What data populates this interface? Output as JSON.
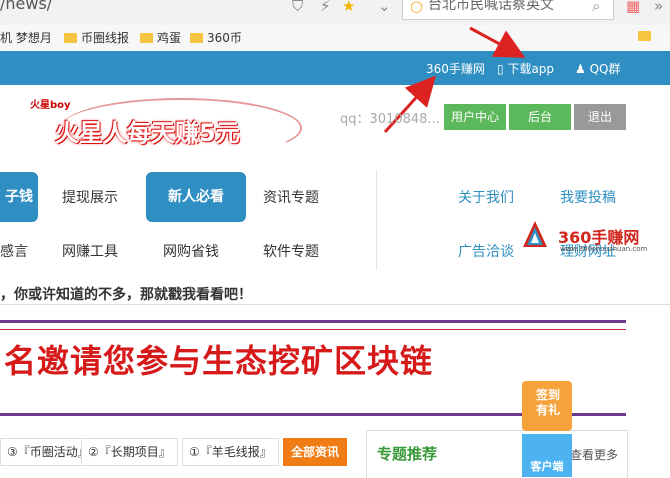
{
  "browser": {
    "url_fragment": "/news/",
    "search_placeholder": "台北市民喊话蔡英文",
    "bookmarks": [
      "机 梦想月",
      "币圈线报",
      "鸡蛋",
      "360币"
    ]
  },
  "topbar": {
    "links": [
      "360手赚网",
      "下载app",
      "QQ群"
    ]
  },
  "header": {
    "logo_small": "火星boy",
    "logo_slogan": "火星人每天赚5元",
    "qq": "qq：3010848...",
    "buttons": [
      "用户中心",
      "后台",
      "退出"
    ],
    "colors": {
      "user_center": "#5cb85c",
      "backend": "#5cb85c",
      "logout": "#999999"
    }
  },
  "nav": {
    "row1": [
      "子钱",
      "提现展示",
      "新人必看",
      "资讯专题"
    ],
    "row2": [
      "感言",
      "网赚工具",
      "网购省钱",
      "软件专题"
    ],
    "right": [
      "关于我们",
      "我要投稿",
      "广告洽谈",
      "理财网址"
    ],
    "brand": {
      "name": "360手赚网",
      "url": "www.360shouzhuan.com"
    }
  },
  "notice": "，你或许知道的不多，那就戳我看看吧！",
  "banner": {
    "text": "名邀请您参与生态挖矿区块链"
  },
  "tabs": [
    "③『币圈活动』",
    "②『长期项目』",
    "①『羊毛线报』"
  ],
  "tab_all": "全部资讯",
  "recommend": {
    "title": "专题推荐",
    "more": "查看更多"
  },
  "floats": {
    "sign": "签到\n有礼",
    "client": "客户端"
  },
  "colors": {
    "accent_blue": "#2f8fc2",
    "orange": "#f07c16",
    "banner_red": "#d61a1a"
  }
}
